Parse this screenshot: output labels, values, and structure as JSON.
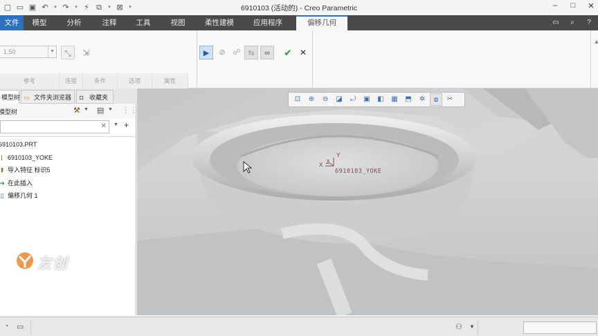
{
  "window": {
    "title": "6910103 (活动的) - Creo Parametric",
    "controls": [
      "–",
      "□",
      "✕"
    ]
  },
  "quick_access": [
    "new-icon",
    "open-icon",
    "save-icon",
    "undo-icon",
    "redo-icon",
    "regenerate-icon",
    "close-window-icon"
  ],
  "ribbon": {
    "file_tab": "文件",
    "tabs": [
      "模型",
      "分析",
      "注释",
      "工具",
      "视图",
      "柔性建模",
      "应用程序"
    ],
    "active_tab": "偏移几何",
    "value_field": "1.50",
    "dashboard_tabs": [
      "参考",
      "选项",
      "条件",
      "选项",
      "属性"
    ],
    "panel_labels": {
      "ref": "参考",
      "connect": "连接",
      "cond": "条件",
      "opts": "选项",
      "props": "属性"
    }
  },
  "navigator": {
    "tabs": [
      "模型树",
      "文件夹浏览器",
      "收藏夹"
    ],
    "tree_title": "模型树",
    "search_placeholder": "",
    "items": [
      {
        "label": "6910103.PRT",
        "icon": "part-icon"
      },
      {
        "label": "6910103_YOKE",
        "icon": "csys-icon"
      },
      {
        "label": "导入特征 标识5",
        "icon": "import-feature-icon"
      },
      {
        "label": "在此插入",
        "icon": "insert-here-arrow-icon"
      },
      {
        "label": "偏移几何 1",
        "icon": "offset-geometry-icon"
      }
    ]
  },
  "viewport": {
    "csys_label": "6910103_YOKE",
    "axes": {
      "x": "X",
      "y": "Y",
      "z": "Z"
    }
  },
  "watermark": "友创",
  "colors": {
    "file_tab": "#2e6fbe",
    "tab_bar": "#4a4a4a",
    "confirm": "#2e9a3c",
    "model_gray": "#c9cbcd"
  }
}
